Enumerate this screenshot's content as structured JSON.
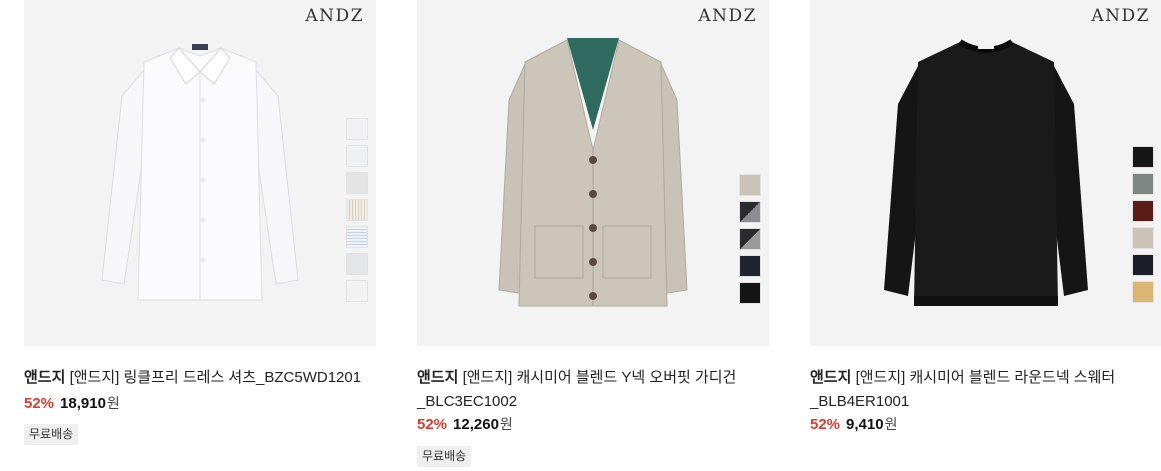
{
  "products": [
    {
      "brand_mark": "ANDZ",
      "seller": "앤드지",
      "name": "[앤드지] 링클프리 드레스 셔츠_BZC5WD1201",
      "discount": "52%",
      "price": "18,910",
      "currency": "원",
      "badge": "무료배송",
      "swatches": [
        "#f1f1f3",
        "#eef0f2",
        "#e4e4e4",
        "#e9e3d9",
        "#dfe4ef",
        "#e3e5e7",
        "#f2f2f2"
      ]
    },
    {
      "brand_mark": "ANDZ",
      "seller": "앤드지",
      "name": "[앤드지] 캐시미어 블렌드 Y넥 오버핏 가디건_BLC3EC1002",
      "discount": "52%",
      "price": "12,260",
      "currency": "원",
      "badge": "무료배송",
      "swatches": [
        "#c9c3b8",
        "#5a5a5c",
        "#2b2b2d",
        "#1f2430",
        "#141414"
      ]
    },
    {
      "brand_mark": "ANDZ",
      "seller": "앤드지",
      "name": "[앤드지] 캐시미어 블렌드 라운드넥 스웨터_BLB4ER1001",
      "discount": "52%",
      "price": "9,410",
      "currency": "원",
      "swatches": [
        "#161616",
        "#7c8784",
        "#5a1d16",
        "#cdc3b6",
        "#1c1e28",
        "#d9b772"
      ]
    }
  ]
}
